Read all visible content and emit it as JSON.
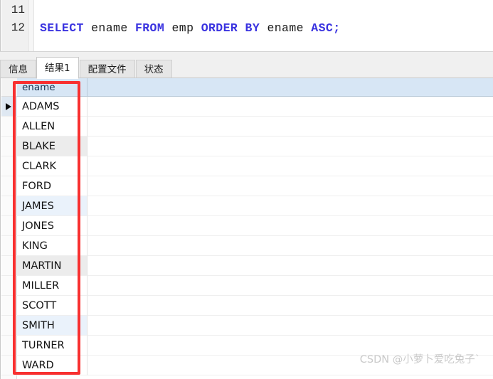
{
  "editor": {
    "lines": [
      {
        "number": "11",
        "tokens": []
      },
      {
        "number": "12",
        "tokens": [
          {
            "t": "SELECT",
            "k": "kw"
          },
          {
            "t": " ",
            "k": "sp"
          },
          {
            "t": "ename",
            "k": "id"
          },
          {
            "t": " ",
            "k": "sp"
          },
          {
            "t": "FROM",
            "k": "kw"
          },
          {
            "t": " ",
            "k": "sp"
          },
          {
            "t": "emp",
            "k": "id"
          },
          {
            "t": " ",
            "k": "sp"
          },
          {
            "t": "ORDER",
            "k": "kw"
          },
          {
            "t": " ",
            "k": "sp"
          },
          {
            "t": "BY",
            "k": "kw"
          },
          {
            "t": " ",
            "k": "sp"
          },
          {
            "t": "ename",
            "k": "id"
          },
          {
            "t": " ",
            "k": "sp"
          },
          {
            "t": "ASC",
            "k": "kw"
          },
          {
            "t": ";",
            "k": "punc"
          }
        ]
      }
    ],
    "line_11_number": "11",
    "line_12_number": "12",
    "sql_text": "SELECT ename FROM emp ORDER BY ename ASC;",
    "keyword_color": "#3a33e0",
    "identifier_color": "#1a1a1a",
    "gutter_color": "#f0f0f0"
  },
  "tabs": {
    "items": [
      {
        "label": "信息",
        "active": false
      },
      {
        "label": "结果1",
        "active": true
      },
      {
        "label": "配置文件",
        "active": false
      },
      {
        "label": "状态",
        "active": false
      }
    ]
  },
  "result_grid": {
    "header_background": "#d7e6f5",
    "columns": [
      "ename"
    ],
    "current_row_index": 0,
    "row_count": 14,
    "rows": [
      {
        "ename": "ADAMS",
        "style": "row-white",
        "current": true
      },
      {
        "ename": "ALLEN",
        "style": "row-white",
        "current": false
      },
      {
        "ename": "BLAKE",
        "style": "row-gray",
        "current": false
      },
      {
        "ename": "CLARK",
        "style": "row-white",
        "current": false
      },
      {
        "ename": "FORD",
        "style": "row-white",
        "current": false
      },
      {
        "ename": "JAMES",
        "style": "row-blue",
        "current": false
      },
      {
        "ename": "JONES",
        "style": "row-white",
        "current": false
      },
      {
        "ename": "KING",
        "style": "row-white",
        "current": false
      },
      {
        "ename": "MARTIN",
        "style": "row-gray",
        "current": false
      },
      {
        "ename": "MILLER",
        "style": "row-white",
        "current": false
      },
      {
        "ename": "SCOTT",
        "style": "row-white",
        "current": false
      },
      {
        "ename": "SMITH",
        "style": "row-blue",
        "current": false
      },
      {
        "ename": "TURNER",
        "style": "row-white",
        "current": false
      },
      {
        "ename": "WARD",
        "style": "row-white",
        "current": false
      }
    ]
  },
  "annotation": {
    "color": "#f83030",
    "shape": "rectangle"
  },
  "watermark": {
    "text": "CSDN @小萝卜爱吃兔子`",
    "color": "#c9c9c9"
  }
}
